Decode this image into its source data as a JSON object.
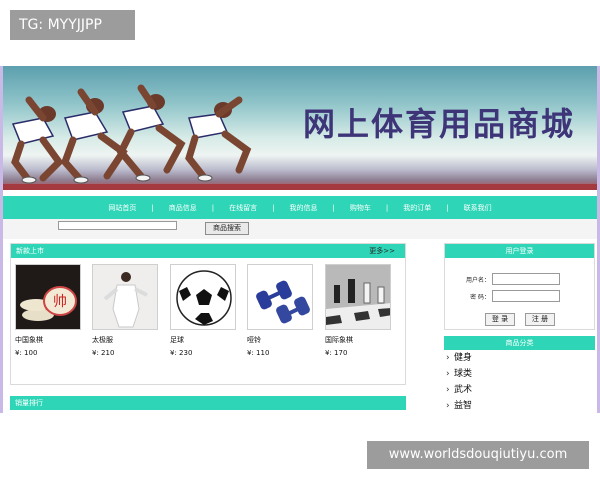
{
  "watermark_top": "TG: MYYJJPP",
  "watermark_bottom": "www.worldsdouqiutiyu.com",
  "banner": {
    "title": "网上体育用品商城"
  },
  "nav": {
    "items": [
      "网站首页",
      "商品信息",
      "在线留言",
      "我的信息",
      "购物车",
      "我的订单",
      "联系我们"
    ]
  },
  "search": {
    "button_label": "商品搜索",
    "value": ""
  },
  "new_products": {
    "title": "新款上市",
    "more": "更多>>",
    "items": [
      {
        "name": "中国象棋",
        "price": "¥: 100",
        "icon": "chinese-chess-image"
      },
      {
        "name": "太极服",
        "price": "¥: 210",
        "icon": "taichi-suit-image"
      },
      {
        "name": "足球",
        "price": "¥: 230",
        "icon": "football-image"
      },
      {
        "name": "哑铃",
        "price": "¥: 110",
        "icon": "dumbbell-image"
      },
      {
        "name": "国际象棋",
        "price": "¥: 170",
        "icon": "chess-image"
      }
    ]
  },
  "sales_rank": {
    "title": "销量排行"
  },
  "login": {
    "title": "用户登录",
    "username_label": "用户名：",
    "password_label": "密  码：",
    "username_value": "",
    "password_value": "",
    "login_button": "登 录",
    "register_button": "注 册"
  },
  "categories": {
    "title": "商品分类",
    "items": [
      "健身",
      "球类",
      "武术",
      "益智"
    ]
  },
  "colors": {
    "accent": "#2ed6b7",
    "banner_title": "#3e3478",
    "frame": "#c9b9e6"
  }
}
